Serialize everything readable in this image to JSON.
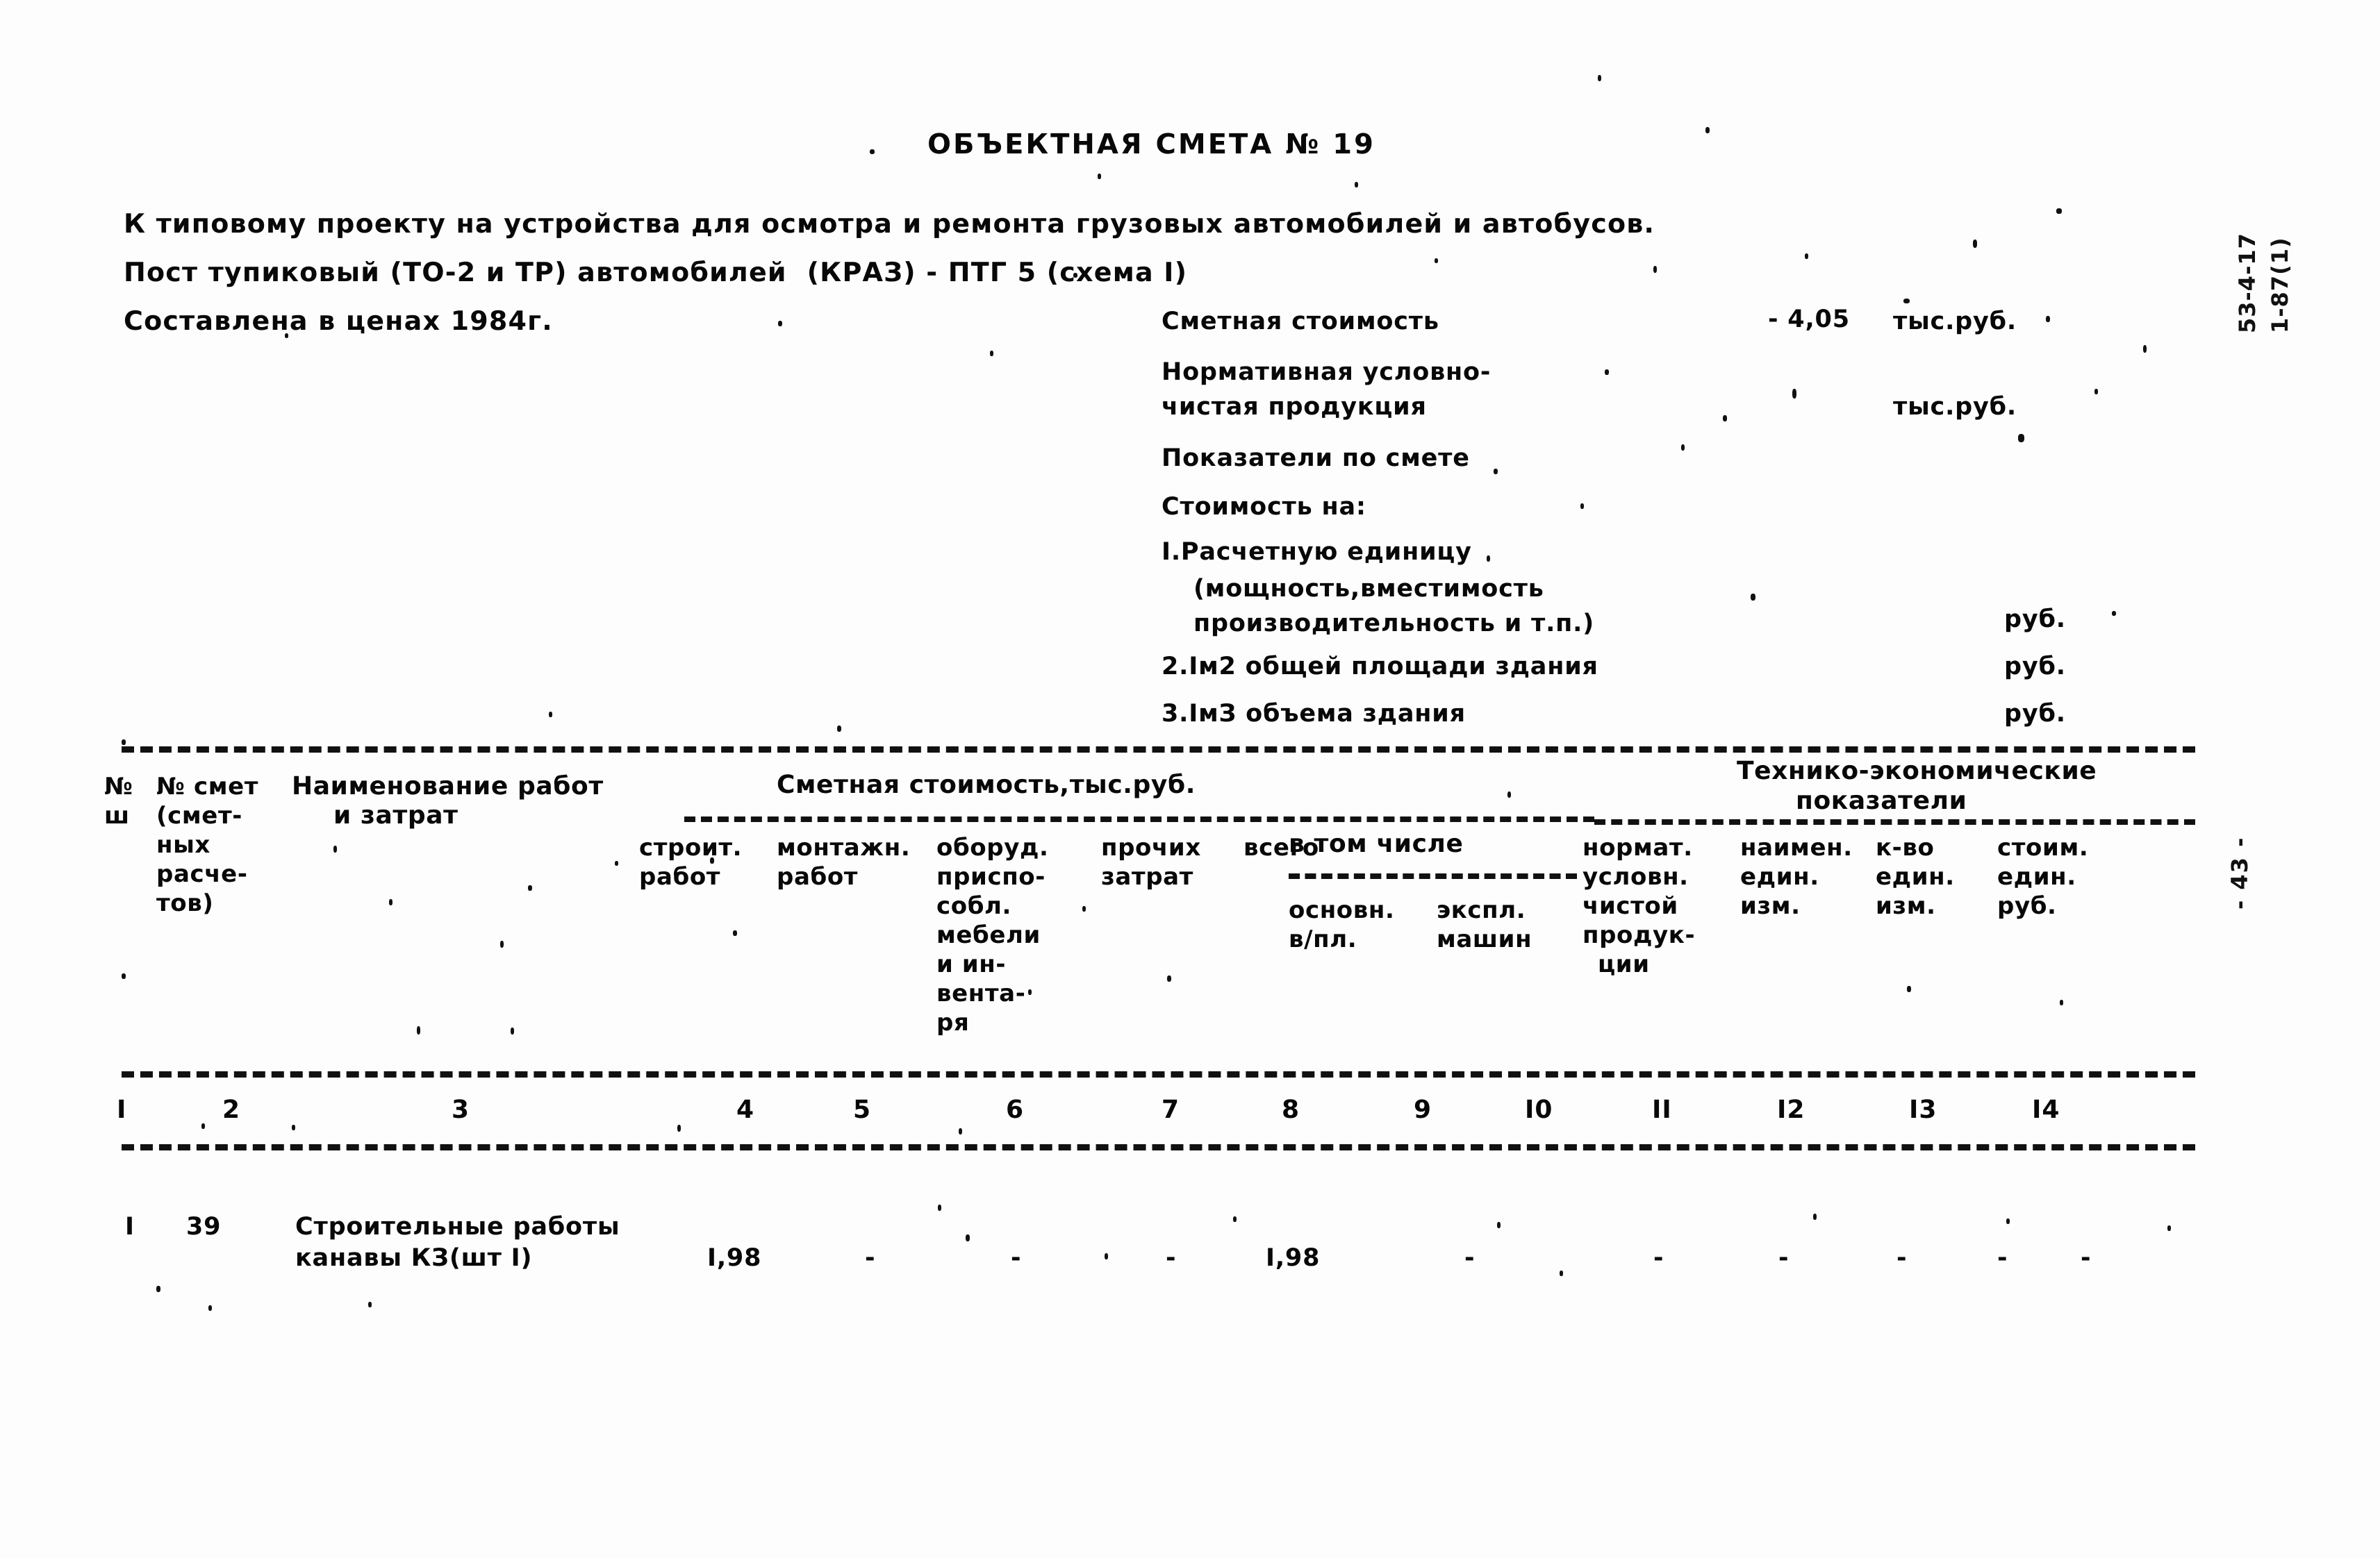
{
  "document": {
    "title": "ОБЪЕКТНАЯ СМЕТА № 19",
    "intro_line_1": "К типовому проекту на устройства для осмотра и ремонта грузовых автомобилей и автобусов.",
    "intro_line_2": "Пост тупиковый (ТО-2 и ТР) автомобилей  (КРАЗ) - ПТГ 5 (схема I)",
    "intro_line_3": "Составлена в ценах 1984г.",
    "margin_code_line_1": "53-4-17",
    "margin_code_line_2": "1-87(1)",
    "margin_page": "- 43 -"
  },
  "summary": {
    "estimated_cost_label": "Сметная стоимость",
    "estimated_cost_value": "- 4,05",
    "estimated_cost_unit": "тыс.руб.",
    "npp_label_line_1": "Нормативная условно-",
    "npp_label_line_2": "чистая продукция",
    "npp_unit": "тыс.руб.",
    "indicators_label": "Показатели по смете",
    "cost_for_label": "Стоимость на:",
    "items": [
      {
        "line_1": "I.Расчетную единицу",
        "line_2": "(мощность,вместимость",
        "line_3": "производительность и т.п.)",
        "unit": "руб."
      },
      {
        "line_1": "2.Iм2 общей площади здания",
        "line_2": "",
        "line_3": "",
        "unit": "руб."
      },
      {
        "line_1": "3.IмЗ объема здания",
        "line_2": "",
        "line_3": "",
        "unit": "руб."
      }
    ]
  },
  "table": {
    "group_headers": {
      "estimate_cost": "Сметная стоимость,тыс.руб.",
      "tech_econ_line_1": "Технико-экономические",
      "tech_econ_line_2": "показатели",
      "included": "в том числе"
    },
    "columns": [
      {
        "num": "I",
        "lines": [
          "№",
          "ш"
        ]
      },
      {
        "num": "2",
        "lines": [
          "№ смет",
          "(смет-",
          "ных",
          "расче-",
          "тов)"
        ]
      },
      {
        "num": "3",
        "lines": [
          "Наименование работ",
          "и затрат"
        ]
      },
      {
        "num": "4",
        "lines": [
          "строит.",
          "работ"
        ]
      },
      {
        "num": "5",
        "lines": [
          "монтажн.",
          "работ"
        ]
      },
      {
        "num": "6",
        "lines": [
          "оборуд.",
          "приспо-",
          "собл.",
          "мебели",
          "и ин-",
          "вента-",
          "ря"
        ]
      },
      {
        "num": "7",
        "lines": [
          "прочих",
          "затрат"
        ]
      },
      {
        "num": "8",
        "lines": [
          "всего"
        ]
      },
      {
        "num": "9",
        "lines": [
          "основн.",
          "в/пл."
        ]
      },
      {
        "num": "I0",
        "lines": [
          "экспл.",
          "машин"
        ]
      },
      {
        "num": "II",
        "lines": [
          "нормат.",
          "условн.",
          "чистой",
          "продук-",
          "ции"
        ]
      },
      {
        "num": "I2",
        "lines": [
          "наимен.",
          "един.",
          "изм."
        ]
      },
      {
        "num": "I3",
        "lines": [
          "к-во",
          "един.",
          "изм."
        ]
      },
      {
        "num": "I4",
        "lines": [
          "стоим.",
          "един.",
          "руб."
        ]
      }
    ],
    "rows": [
      {
        "c1": "I",
        "c2": "39",
        "c3_line_1": "Строительные работы",
        "c3_line_2": "канавы КЗ(шт I)",
        "c4": "I,98",
        "c5": "-",
        "c6": "-",
        "c7": "-",
        "c8": "I,98",
        "c9": "-",
        "c10": "-",
        "c11": "-",
        "c12": "-",
        "c13": "-",
        "c14": "-"
      }
    ]
  }
}
